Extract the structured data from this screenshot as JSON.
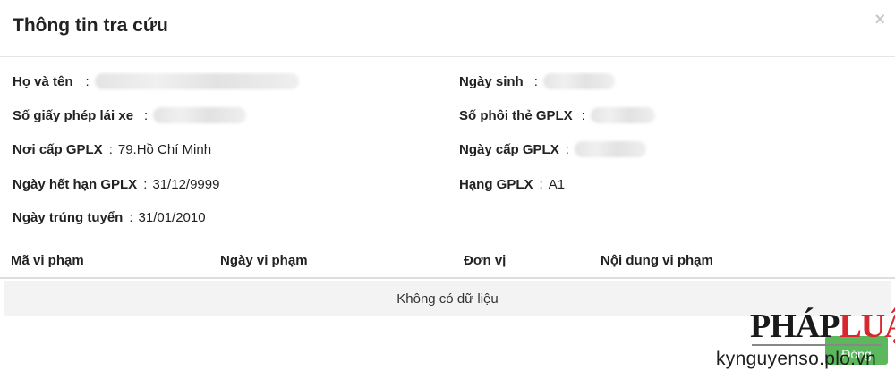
{
  "modal": {
    "title": "Thông tin tra cứu",
    "close_symbol": "×"
  },
  "fields": {
    "full_name": {
      "label": "Họ và tên",
      "value": ""
    },
    "birth_date": {
      "label": "Ngày sinh",
      "value": ""
    },
    "license_no": {
      "label": "Số giấy phép lái xe",
      "value": ""
    },
    "card_serial": {
      "label": "Số phôi thẻ GPLX",
      "value": ""
    },
    "issue_place": {
      "label": "Nơi cấp GPLX",
      "value": "79.Hồ Chí Minh"
    },
    "issue_date": {
      "label": "Ngày cấp GPLX",
      "value": ""
    },
    "expiry_date": {
      "label": "Ngày hết hạn GPLX",
      "value": "31/12/9999"
    },
    "license_class": {
      "label": "Hạng GPLX",
      "value": "A1"
    },
    "exam_pass_date": {
      "label": "Ngày trúng tuyển",
      "value": "31/01/2010"
    }
  },
  "violations_table": {
    "columns": [
      "Mã vi phạm",
      "Ngày vi phạm",
      "Đơn vị",
      "Nội dung vi phạm"
    ],
    "empty_text": "Không có dữ liệu"
  },
  "footer": {
    "close_button": "Đóng"
  },
  "watermark": {
    "logo_text_dark": "PHÁP",
    "logo_text_red": "LUẬT",
    "site": "kynguyenso.plo.vn"
  }
}
